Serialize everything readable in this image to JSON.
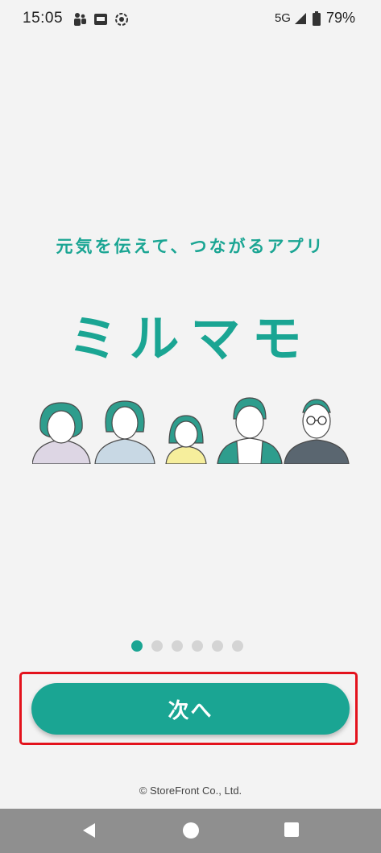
{
  "status_bar": {
    "time": "15:05",
    "network": "5G",
    "battery_percent": "79%",
    "icons": [
      "teams-icon",
      "app-icon",
      "screen-record-icon",
      "signal-icon",
      "battery-icon"
    ]
  },
  "main": {
    "tagline": "元気を伝えて、つながるアプリ",
    "app_name": "ミルマモ",
    "pager": {
      "total": 6,
      "active_index": 0
    },
    "next_button_label": "次へ",
    "copyright": "© StoreFront Co., Ltd."
  },
  "colors": {
    "accent": "#1aa593",
    "highlight": "#e3121c",
    "background": "#f3f3f3",
    "nav_bar": "#8f8f8f"
  },
  "nav_bar": {
    "icons": [
      "back-icon",
      "home-icon",
      "recents-icon"
    ]
  }
}
